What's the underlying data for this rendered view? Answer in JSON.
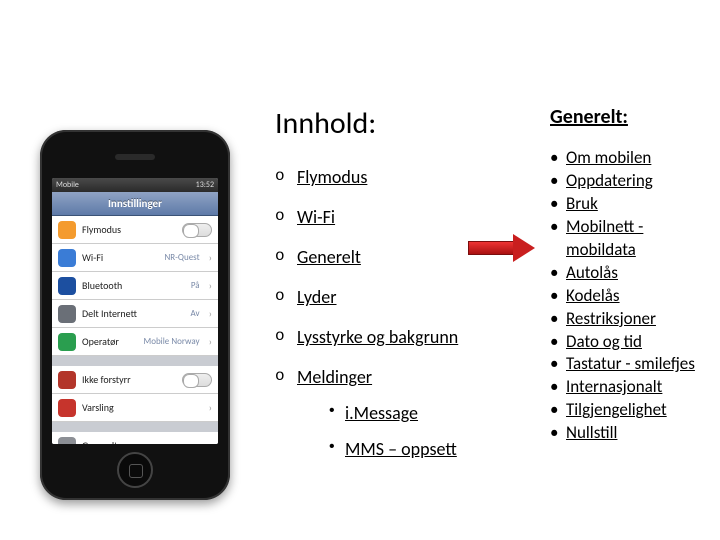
{
  "phone": {
    "status": {
      "carrier": "Mobile",
      "time": "13:52"
    },
    "title": "Innstillinger",
    "rows": [
      {
        "icon": "ic-plane",
        "label": "Flymodus",
        "type": "toggle",
        "on": false
      },
      {
        "icon": "ic-wifi",
        "label": "Wi-Fi",
        "type": "detail",
        "detail": "NR-Quest"
      },
      {
        "icon": "ic-bt",
        "label": "Bluetooth",
        "type": "detail",
        "detail": "På"
      },
      {
        "icon": "ic-share",
        "label": "Delt Internett",
        "type": "detail",
        "detail": "Av"
      },
      {
        "icon": "ic-op",
        "label": "Operatør",
        "type": "detail",
        "detail": "Mobile Norway"
      }
    ],
    "rows2": [
      {
        "icon": "ic-dnd",
        "label": "Ikke forstyrr",
        "type": "toggle",
        "on": false
      },
      {
        "icon": "ic-notif",
        "label": "Varsling",
        "type": "chev"
      }
    ],
    "rows3": [
      {
        "icon": "ic-gen",
        "label": "Generelt",
        "type": "chev"
      }
    ]
  },
  "innhold": {
    "heading": "Innhold:",
    "items": [
      "Flymodus",
      "Wi-Fi",
      "Generelt",
      "Lyder",
      "Lysstyrke og bakgrunn",
      "Meldinger"
    ],
    "sub": [
      "i.Message",
      "MMS – oppsett "
    ]
  },
  "generelt": {
    "heading": "Generelt:",
    "items": [
      "Om mobilen",
      "Oppdatering",
      "Bruk",
      "Mobilnett - mobildata",
      "Autolås",
      "Kodelås",
      "Restriksjoner",
      "Dato og tid",
      "Tastatur  - smilefjes",
      "Internasjonalt",
      "Tilgjengelighet",
      "Nullstill"
    ]
  }
}
